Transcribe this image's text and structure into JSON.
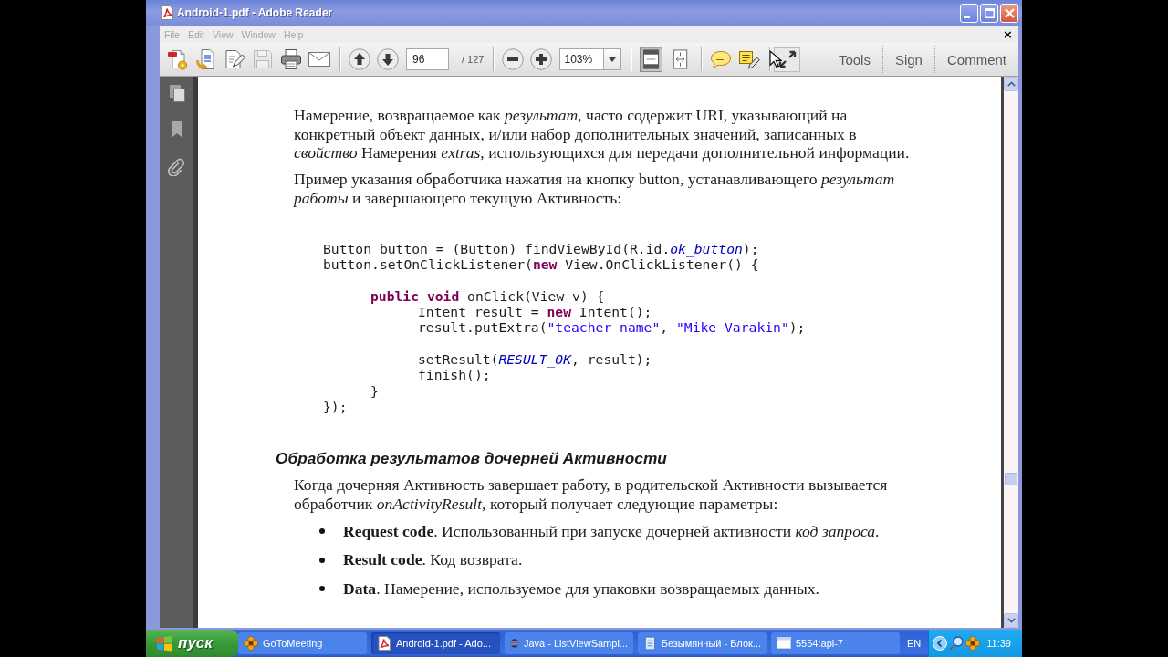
{
  "window": {
    "title": "Android-1.pdf - Adobe Reader"
  },
  "menu": {
    "items": [
      "File",
      "Edit",
      "View",
      "Window",
      "Help"
    ],
    "close_document": "×"
  },
  "toolbar": {
    "file_buttons": [
      {
        "disabled": false
      },
      {
        "disabled": false
      },
      {
        "disabled": false
      },
      {
        "disabled": true
      },
      {
        "disabled": false
      },
      {
        "disabled": false
      }
    ],
    "page_field": {
      "value": "96"
    },
    "page_count": "/ 127",
    "zoom_field": {
      "value": "103%"
    },
    "view_buttons": [
      {
        "selected": true
      },
      {
        "selected": false
      }
    ],
    "panels": [
      "Tools",
      "Sign",
      "Comment"
    ]
  },
  "document": {
    "blocks": [
      {
        "kind": "paragraph",
        "text": "Намерение, возвращаемое как *результат*, часто содержит URI, указывающий на\nконкретный объект данных, и/или набор дополнительных значений, записанных в\n*свойство* Намерения *extras*, использующихся для передачи дополнительной информации."
      },
      {
        "kind": "paragraph",
        "text": "Пример указания обработчика нажатия на кнопку button, устанавливающего *результат*\n*работы* и завершающего текущую Активность:"
      },
      {
        "kind": "code",
        "lines": [
          {
            "kind": "line",
            "segments": [
              {
                "kind": "plain",
                "text": "Button button = (Button) findViewById(R.id."
              },
              {
                "kind": "field",
                "text": "ok_button"
              },
              {
                "kind": "plain",
                "text": ");"
              }
            ]
          },
          {
            "kind": "line",
            "segments": [
              {
                "kind": "plain",
                "text": "button.setOnClickListener("
              },
              {
                "kind": "keyword",
                "text": "new"
              },
              {
                "kind": "plain",
                "text": " View.OnClickListener() {"
              }
            ],
            "children": [
              {
                "kind": "blank"
              },
              {
                "kind": "line",
                "segments": [
                  {
                    "kind": "keyword",
                    "text": "public void"
                  },
                  {
                    "kind": "plain",
                    "text": " onClick(View v) {"
                  }
                ],
                "children": [
                  {
                    "kind": "line",
                    "segments": [
                      {
                        "kind": "plain",
                        "text": "Intent result = "
                      },
                      {
                        "kind": "keyword",
                        "text": "new"
                      },
                      {
                        "kind": "plain",
                        "text": " Intent();"
                      }
                    ]
                  },
                  {
                    "kind": "line",
                    "segments": [
                      {
                        "kind": "plain",
                        "text": "result.putExtra("
                      },
                      {
                        "kind": "string",
                        "text": "\"teacher name\""
                      },
                      {
                        "kind": "plain",
                        "text": ", "
                      },
                      {
                        "kind": "string",
                        "text": "\"Mike Varakin\""
                      },
                      {
                        "kind": "plain",
                        "text": ");"
                      }
                    ]
                  },
                  {
                    "kind": "blank"
                  },
                  {
                    "kind": "line",
                    "segments": [
                      {
                        "kind": "plain",
                        "text": "setResult("
                      },
                      {
                        "kind": "field",
                        "text": "RESULT_OK"
                      },
                      {
                        "kind": "plain",
                        "text": ", result);"
                      }
                    ]
                  },
                  {
                    "kind": "line",
                    "segments": [
                      {
                        "kind": "plain",
                        "text": "finish();"
                      }
                    ]
                  }
                ]
              },
              {
                "kind": "line",
                "segments": [
                  {
                    "kind": "plain",
                    "text": "}"
                  }
                ]
              }
            ]
          },
          {
            "kind": "line",
            "segments": [
              {
                "kind": "plain",
                "text": "});"
              }
            ]
          }
        ]
      },
      {
        "kind": "heading",
        "text": "Обработка результатов дочерней Активности"
      },
      {
        "kind": "paragraph",
        "text": "Когда дочерняя Активность завершает работу, в родительской Активности вызывается\nобработчик *onActivityResult*, который получает следующие параметры:"
      },
      {
        "kind": "bullet",
        "text": "**Request code**. Использованный при запуске дочерней активности *код запроса*."
      },
      {
        "kind": "bullet",
        "text": "**Result code**. Код возврата."
      },
      {
        "kind": "bullet",
        "text": "**Data**. Намерение, используемое для упаковки возвращаемых данных."
      }
    ]
  },
  "taskbar": {
    "start": "пуск",
    "tasks": [
      {
        "label": "GoToMeeting",
        "selected": false
      },
      {
        "label": "Android-1.pdf - Ado...",
        "selected": true
      },
      {
        "label": "Java - ListViewSampl...",
        "selected": false
      },
      {
        "label": "Безымянный - Блок...",
        "selected": false
      },
      {
        "label": "5554:api-7",
        "selected": false
      }
    ],
    "language": "EN",
    "clock": "11:39"
  }
}
